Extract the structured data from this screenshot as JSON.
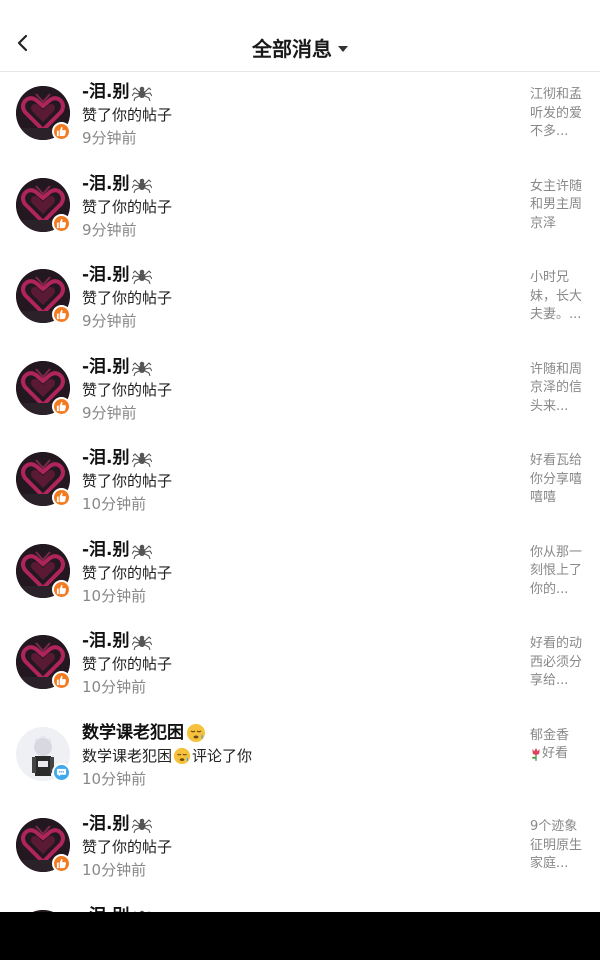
{
  "header": {
    "title": "全部消息"
  },
  "colors": {
    "like_badge": "#f47a20",
    "comment_badge": "#3da8ee",
    "time_text": "#888888",
    "bottom_bar": "#000000"
  },
  "messages": [
    {
      "name": "-泪.别",
      "name_icon": "spider-icon",
      "action": "赞了你的帖子",
      "time": "9分钟前",
      "preview": "江彻和孟听发的爱不多...",
      "type": "like",
      "avatar": "heart-avatar"
    },
    {
      "name": "-泪.别",
      "name_icon": "spider-icon",
      "action": "赞了你的帖子",
      "time": "9分钟前",
      "preview": "女主许随和男主周京泽",
      "type": "like",
      "avatar": "heart-avatar"
    },
    {
      "name": "-泪.别",
      "name_icon": "spider-icon",
      "action": "赞了你的帖子",
      "time": "9分钟前",
      "preview": "小时兄妹，长大夫妻。...",
      "type": "like",
      "avatar": "heart-avatar"
    },
    {
      "name": "-泪.别",
      "name_icon": "spider-icon",
      "action": "赞了你的帖子",
      "time": "9分钟前",
      "preview": "许随和周京泽的信头来...",
      "type": "like",
      "avatar": "heart-avatar"
    },
    {
      "name": "-泪.别",
      "name_icon": "spider-icon",
      "action": "赞了你的帖子",
      "time": "10分钟前",
      "preview": "好看瓦给你分享嘻嘻嘻",
      "type": "like",
      "avatar": "heart-avatar"
    },
    {
      "name": "-泪.别",
      "name_icon": "spider-icon",
      "action": "赞了你的帖子",
      "time": "10分钟前",
      "preview": "你从那一刻恨上了你的...",
      "type": "like",
      "avatar": "heart-avatar"
    },
    {
      "name": "-泪.别",
      "name_icon": "spider-icon",
      "action": "赞了你的帖子",
      "time": "10分钟前",
      "preview": "好看的动西必须分享给...",
      "type": "like",
      "avatar": "heart-avatar"
    },
    {
      "name": "数学课老犯困",
      "name_icon": "sleepy-face-icon",
      "action": "数学课老犯困",
      "action_suffix": "评论了你",
      "time": "10分钟前",
      "preview_line1": "郁金香",
      "preview_line2": "好看",
      "type": "comment",
      "avatar": "person-avatar"
    },
    {
      "name": "-泪.别",
      "name_icon": "spider-icon",
      "action": "赞了你的帖子",
      "time": "10分钟前",
      "preview": "9个迹象征明原生家庭...",
      "type": "like",
      "avatar": "heart-avatar"
    },
    {
      "name": "-泪.别",
      "name_icon": "spider-icon",
      "action": "",
      "time": "",
      "preview": "",
      "type": "like",
      "avatar": "heart-avatar"
    }
  ]
}
